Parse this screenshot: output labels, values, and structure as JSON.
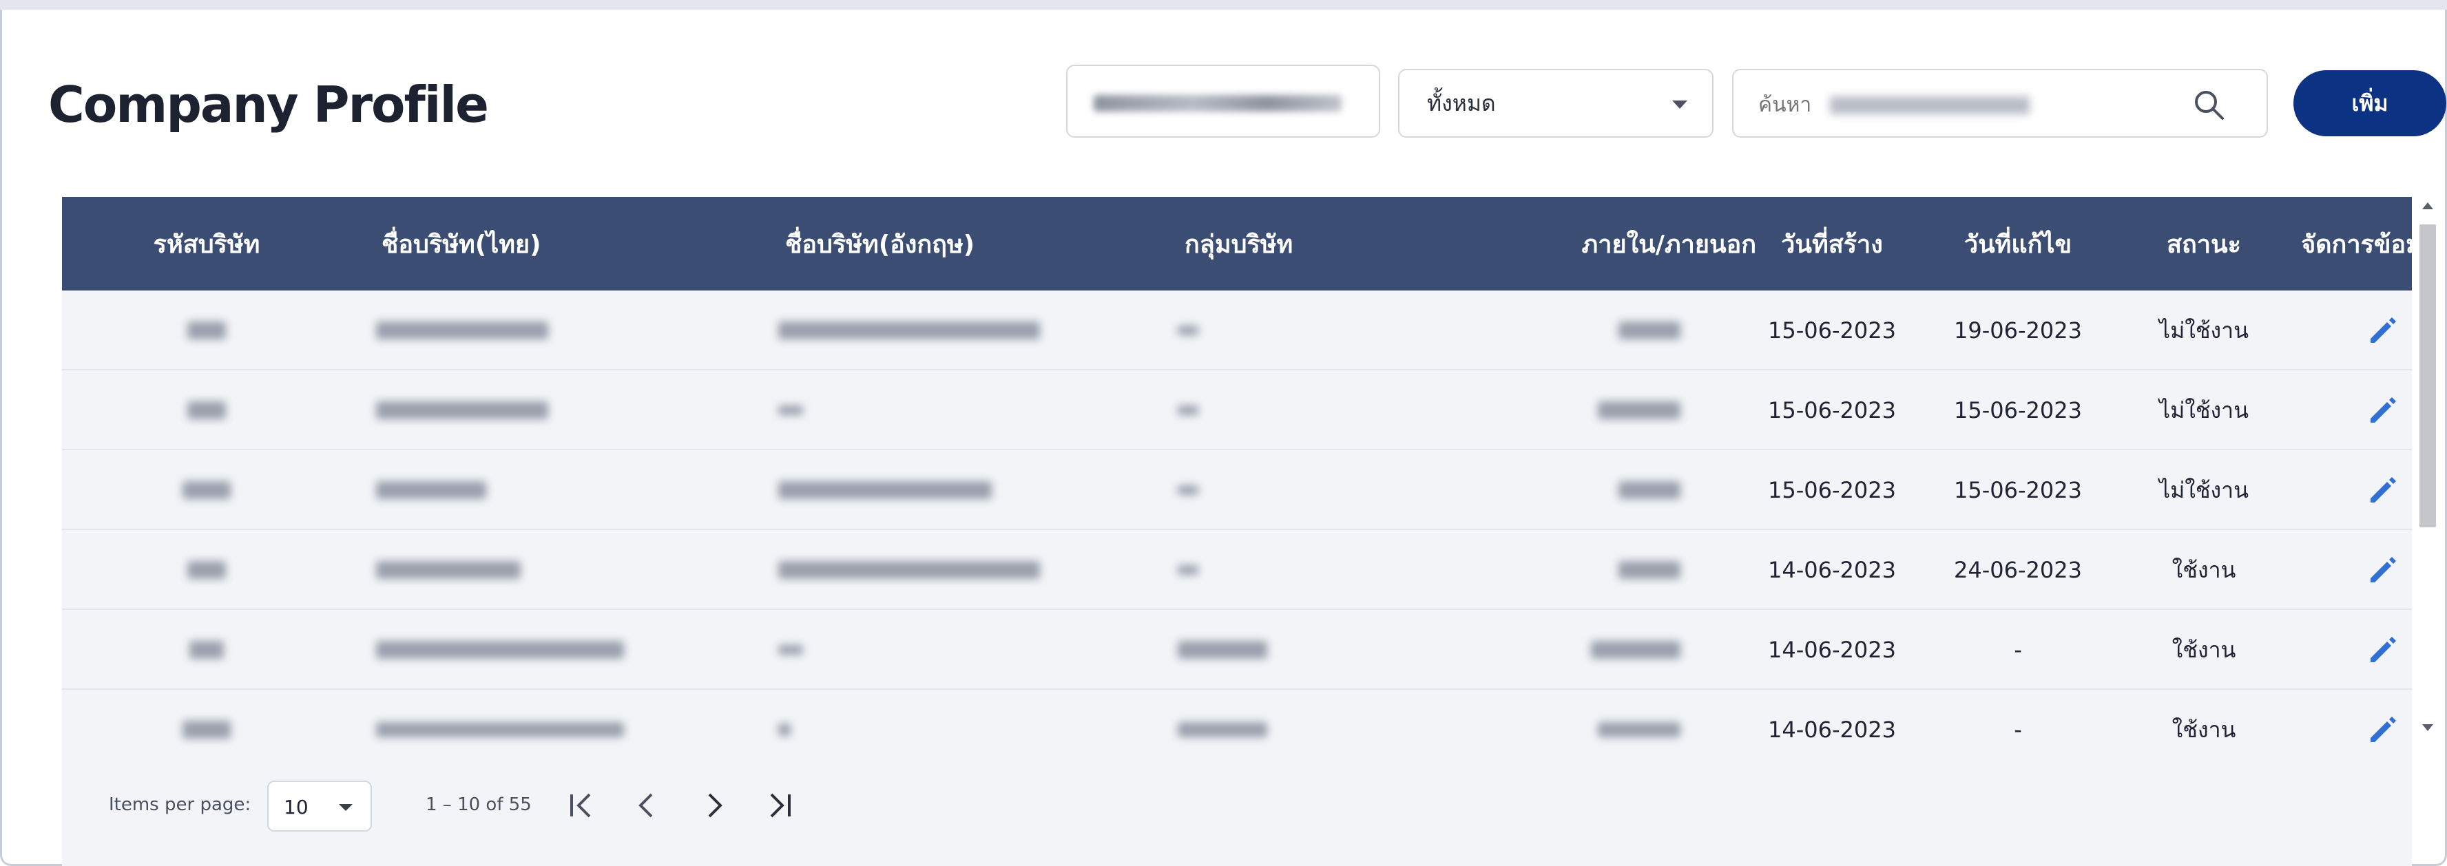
{
  "page": {
    "title": "Company Profile"
  },
  "toolbar": {
    "type_filter_value": "ทั้งหมด",
    "search_placeholder": "ค้นหา",
    "add_label": "เพิ่ม"
  },
  "table": {
    "headers": {
      "code": "รหัสบริษัท",
      "name_th": "ชื่อบริษัท(ไทย)",
      "name_en": "ชื่อบริษัท(อังกฤษ)",
      "group": "กลุ่มบริษัท",
      "scope": "ภายใน/ภายนอก",
      "created": "วันที่สร้าง",
      "modified": "วันที่แก้ไข",
      "status": "สถานะ",
      "actions": "จัดการข้อมูล"
    },
    "rows": [
      {
        "created": "15-06-2023",
        "modified": "19-06-2023",
        "status": "ไม่ใช้งาน"
      },
      {
        "created": "15-06-2023",
        "modified": "15-06-2023",
        "status": "ไม่ใช้งาน"
      },
      {
        "created": "15-06-2023",
        "modified": "15-06-2023",
        "status": "ไม่ใช้งาน"
      },
      {
        "created": "14-06-2023",
        "modified": "24-06-2023",
        "status": "ใช้งาน"
      },
      {
        "created": "14-06-2023",
        "modified": "-",
        "status": "ใช้งาน"
      },
      {
        "created": "14-06-2023",
        "modified": "-",
        "status": "ใช้งาน"
      }
    ]
  },
  "paginator": {
    "items_per_page_label": "Items per page:",
    "items_per_page_value": "10",
    "range_label": "1 – 10 of 55"
  },
  "colors": {
    "header_bg": "#3b4d73",
    "add_button": "#0b3283",
    "edit_icon": "#2f6fd6",
    "table_bg": "#f2f4f7"
  },
  "icons": {
    "search": "search-icon",
    "edit": "pencil-icon",
    "first_page": "first-page-icon",
    "prev_page": "chevron-left-icon",
    "next_page": "chevron-right-icon",
    "last_page": "last-page-icon"
  }
}
